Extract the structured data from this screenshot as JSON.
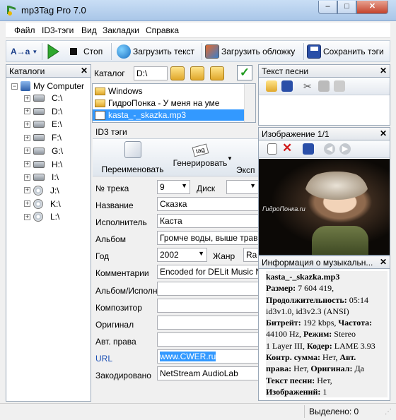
{
  "window": {
    "title": "mp3Tag Pro 7.0",
    "min": "‒",
    "max": "□",
    "close": "✕"
  },
  "menu": [
    "Файл",
    "ID3-тэги",
    "Вид",
    "Закладки",
    "Справка"
  ],
  "toolbar": {
    "case_label": "A→a",
    "stop_label": "Стоп",
    "load_text_label": "Загрузить текст",
    "load_cover_label": "Загрузить обложку",
    "save_tags_label": "Сохранить тэги"
  },
  "catalogs": {
    "title": "Каталоги",
    "root": "My Computer",
    "drives": [
      "C:\\",
      "D:\\",
      "E:\\",
      "F:\\",
      "G:\\",
      "H:\\",
      "I:\\",
      "J:\\",
      "K:\\",
      "L:\\"
    ]
  },
  "catalog_bar": {
    "label": "Каталог",
    "value": "D:\\",
    "ok": "✓"
  },
  "files": [
    {
      "name": "Windows",
      "type": "folder"
    },
    {
      "name": "ГидроПонка - У меня на уме",
      "type": "folder"
    },
    {
      "name": "kasta_-_skazka.mp3",
      "type": "mp3",
      "selected": true
    }
  ],
  "id3": {
    "title": "ID3 тэги",
    "rename_label": "Переименовать",
    "generate_label": "Генерировать",
    "export_label": "Эксп",
    "tag_icon_text": "tag",
    "fields": {
      "track_label": "№ трека",
      "track_value": "9",
      "disc_label": "Диск",
      "disc_value": "",
      "title_label": "Название",
      "title_value": "Сказка",
      "artist_label": "Исполнитель",
      "artist_value": "Каста",
      "album_label": "Альбом",
      "album_value": "Громче воды, выше травы",
      "year_label": "Год",
      "year_value": "2002",
      "genre_label": "Жанр",
      "genre_value": "Ra",
      "comment_label": "Комментарии",
      "comment_value": "Encoded for DELit Music Na",
      "album_artist_label": "Альбом/Исполни",
      "album_artist_value": "",
      "composer_label": "Композитор",
      "composer_value": "",
      "original_label": "Оригинал",
      "original_value": "",
      "copyright_label": "Авт. права",
      "copyright_value": "",
      "url_label": "URL",
      "url_value": "www.CWER.ru",
      "encoded_label": "Закодировано",
      "encoded_value": "NetStream AudioLab"
    }
  },
  "lyrics": {
    "title": "Текст песни",
    "close": "✕"
  },
  "image": {
    "title": "Изображение 1/1",
    "caption": "ГидроПонка.ru",
    "close": "✕"
  },
  "info": {
    "title": "Информация о музыкальн...",
    "close": "✕",
    "filename": "kasta_-_skazka.mp3",
    "line1_label": "Размер:",
    "line1_value": "7 604 419,",
    "line2_label": "Продолжительность:",
    "line2_value": "05:14",
    "line3": "id3v1.0, id3v2.3 (ANSI)",
    "line4_label": "Битрейт:",
    "line4_value": "192 kbps,",
    "line4_label2": "Частота:",
    "line5_value": "44100 Hz,",
    "line5_label": "Режим:",
    "line5_value2": "Stereo",
    "line6_value": "1 Layer III,",
    "line6_label": "Кодер:",
    "line6_value2": "LAME 3.93",
    "line7_label": "Контр. сумма:",
    "line7_value": "Нет,",
    "line7_label2": "Авт.",
    "line8_label": "права:",
    "line8_value": "Нет,",
    "line8_label2": "Оригинал:",
    "line8_value2": "Да",
    "line9_label": "Текст песни:",
    "line9_value": "Нет,",
    "line10_label": "Изображений:",
    "line10_value": "1"
  },
  "status": {
    "selected": "Выделено: 0"
  }
}
